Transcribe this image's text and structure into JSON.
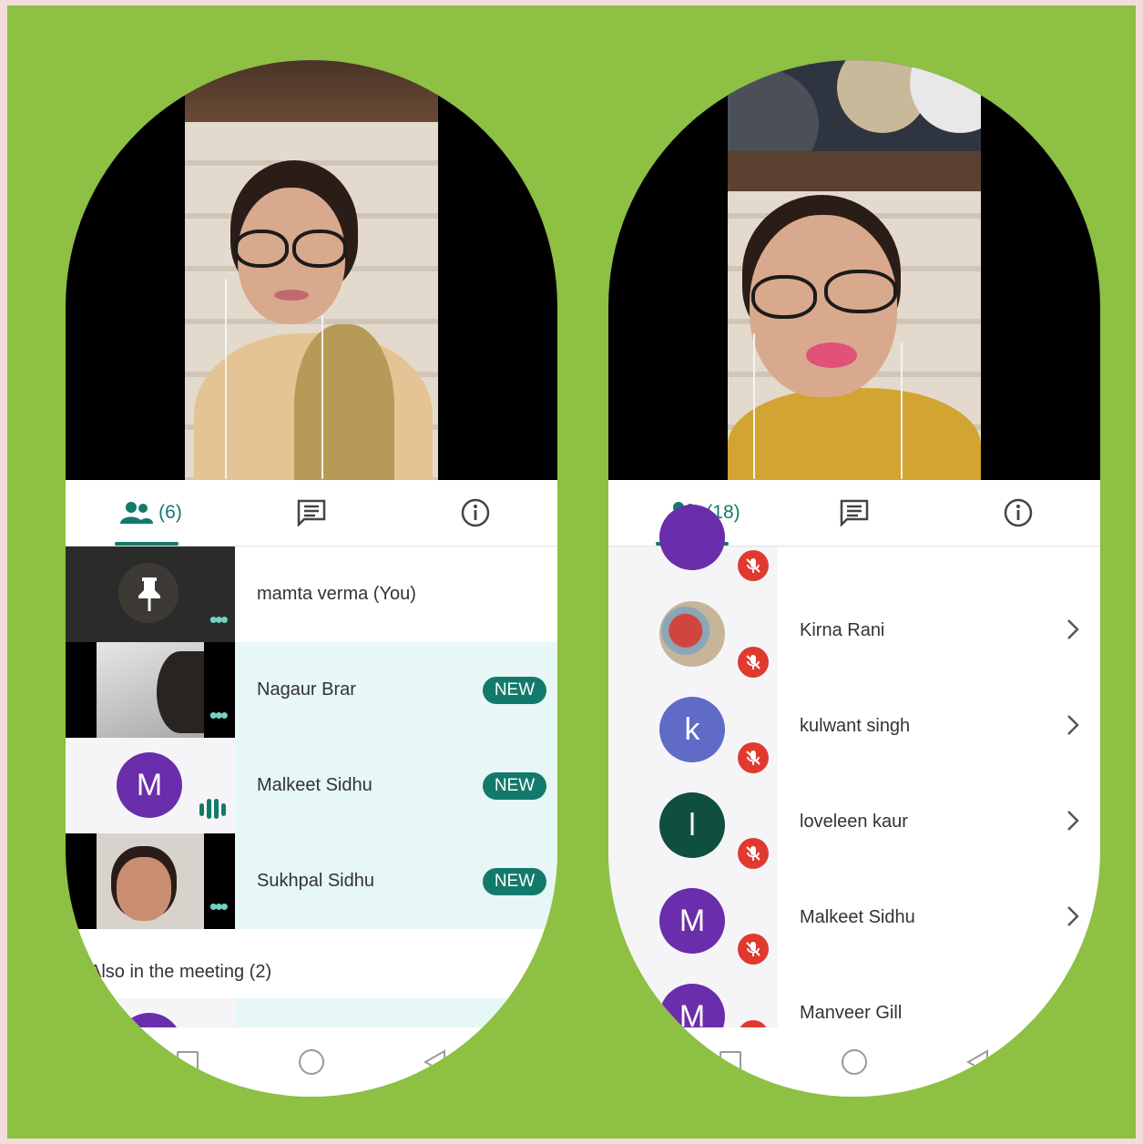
{
  "colors": {
    "accent": "#137a6b",
    "mute": "#e03a30",
    "background": "#8dc043"
  },
  "phone_left": {
    "tabs": {
      "participants_count": "(6)",
      "icons": [
        "people-icon",
        "chat-icon",
        "info-icon"
      ]
    },
    "participants": [
      {
        "name": "mamta verma (You)",
        "badge": ""
      },
      {
        "name": "Nagaur Brar",
        "badge": "NEW"
      },
      {
        "name": "Malkeet Sidhu",
        "badge": "NEW",
        "avatar_letter": "M"
      },
      {
        "name": "Sukhpal Sidhu",
        "badge": "NEW"
      }
    ],
    "section_title": "Also in the meeting (2)"
  },
  "phone_right": {
    "tabs": {
      "participants_count": "(18)",
      "icons": [
        "people-icon",
        "chat-icon",
        "info-icon"
      ]
    },
    "participants": [
      {
        "name": "Kirna Rani",
        "avatar_letter": "",
        "avatar_color": ""
      },
      {
        "name": "kulwant singh",
        "avatar_letter": "k",
        "avatar_color": "#5f6bc7"
      },
      {
        "name": "loveleen kaur",
        "avatar_letter": "l",
        "avatar_color": "#0f4f3e"
      },
      {
        "name": "Malkeet Sidhu",
        "avatar_letter": "M",
        "avatar_color": "#6a2dab"
      },
      {
        "name": "Manveer Gill",
        "avatar_letter": "M",
        "avatar_color": "#6a2dab"
      }
    ]
  }
}
